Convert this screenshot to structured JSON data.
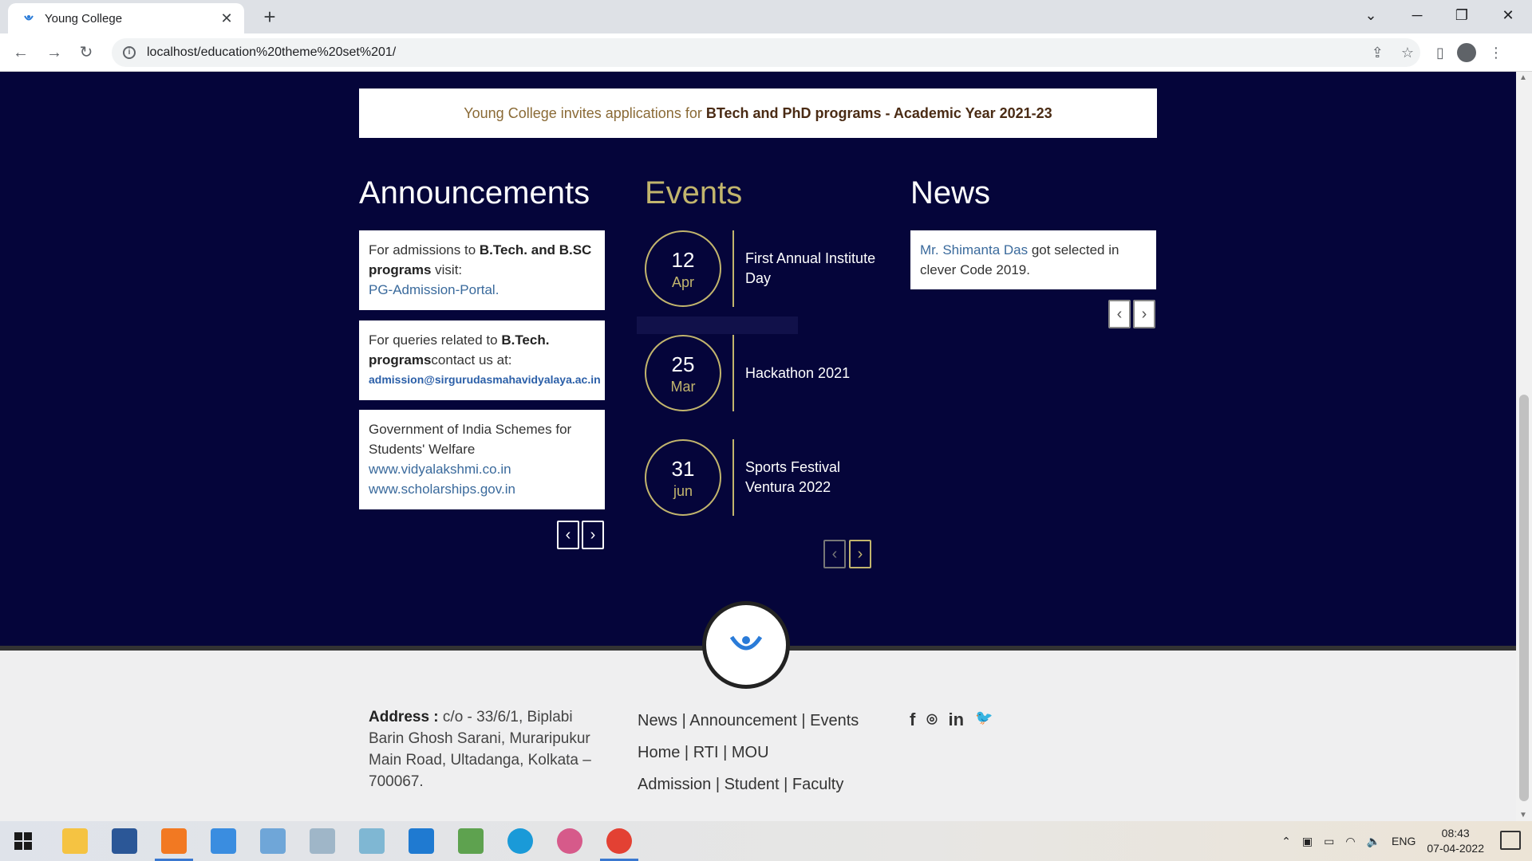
{
  "browser": {
    "tab_title": "Young College",
    "tab_close": "✕",
    "new_tab": "+",
    "url": "localhost/education%20theme%20set%201/",
    "win_min": "─",
    "win_max": "❐",
    "win_close": "✕",
    "tab_search": "⌄"
  },
  "banner": {
    "prefix": "Young College invites applications for ",
    "bold": "BTech and PhD programs - Academic Year 2021-23"
  },
  "announcements": {
    "title": "Announcements",
    "card1": {
      "t1": "For admissions to ",
      "b1": "B.Tech. and B.SC programs",
      "t2": " visit:",
      "link": "PG-Admission-Portal."
    },
    "card2": {
      "t1": "For queries related to ",
      "b1": "B.Tech. programs",
      "t2": "contact us at:",
      "email": "admission@sirgurudasmahavidyalaya.ac.in"
    },
    "card3": {
      "t1": "Government of India Schemes for Students' Welfare",
      "link1": "www.vidyalakshmi.co.in",
      "link2": "www.scholarships.gov.in"
    }
  },
  "events": {
    "title": "Events",
    "items": [
      {
        "day": "12",
        "month": "Apr",
        "title": "First Annual Institute Day"
      },
      {
        "day": "25",
        "month": "Mar",
        "title": "Hackathon 2021"
      },
      {
        "day": "31",
        "month": "jun",
        "title": "Sports Festival Ventura 2022"
      }
    ]
  },
  "news": {
    "title": "News",
    "name": "Mr. Shimanta Das",
    "text": " got selected in clever Code 2019."
  },
  "footer": {
    "address_label": "Address :",
    "address": " c/o - 33/6/1, Biplabi Barin Ghosh Sarani, Muraripukur Main Road, Ultadanga, Kolkata – 700067.",
    "links_row1": [
      "News",
      "Announcement",
      "Events"
    ],
    "links_row2": [
      "Home",
      "RTI",
      "MOU"
    ],
    "links_row3": [
      "Admission",
      "Student",
      "Faculty"
    ],
    "separator": "|",
    "social": {
      "facebook": "f",
      "github": "⌾",
      "linkedin": "in",
      "twitter": "🐦"
    }
  },
  "taskbar": {
    "lang": "ENG",
    "time": "08:43",
    "date": "07-04-2022"
  },
  "icons": {
    "prev": "‹",
    "next": "›"
  }
}
